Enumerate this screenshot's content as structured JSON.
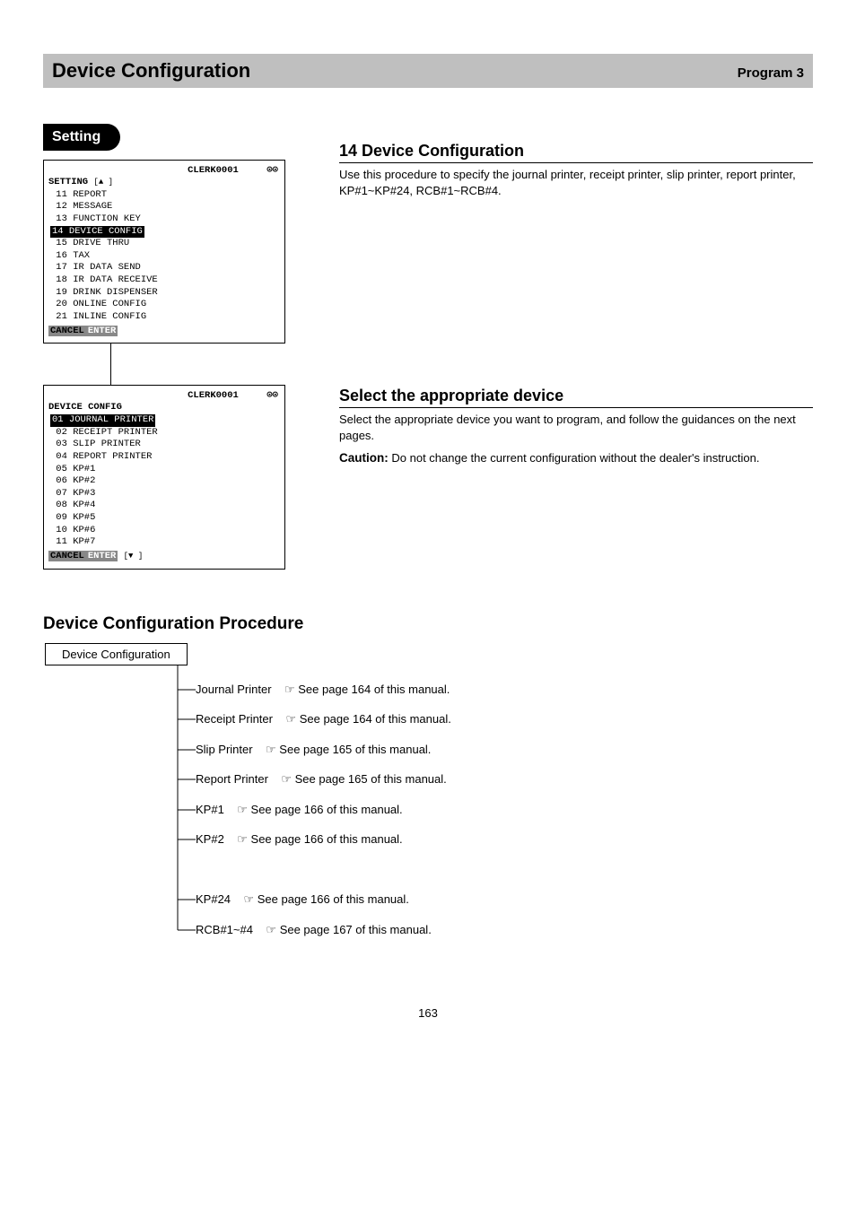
{
  "header": {
    "title": "Device Configuration",
    "sub": "Program 3"
  },
  "tab": "Setting",
  "screen1": {
    "user": "CLERK0001",
    "indicator": "⊙⊙",
    "menu_title": "SETTING",
    "up_marker": "[▲ ]",
    "items": [
      "11 REPORT",
      "12 MESSAGE",
      "13 FUNCTION KEY",
      "14 DEVICE CONFIG",
      "15 DRIVE THRU",
      "16 TAX",
      "17 IR DATA SEND",
      "18 IR DATA RECEIVE",
      "19 DRINK DISPENSER",
      "20 ONLINE CONFIG",
      "21 INLINE CONFIG"
    ],
    "selected_index": 3,
    "cancel": "CANCEL",
    "enter": "ENTER"
  },
  "right1": {
    "heading": "14 Device Configuration",
    "text": "Use this procedure to specify the journal printer, receipt printer, slip printer, report printer, KP#1~KP#24, RCB#1~RCB#4."
  },
  "screen2": {
    "user": "CLERK0001",
    "indicator": "⊙⊙",
    "menu_title": "DEVICE CONFIG",
    "items": [
      "01 JOURNAL PRINTER",
      "02 RECEIPT PRINTER",
      "03 SLIP PRINTER",
      "04 REPORT PRINTER",
      "05 KP#1",
      "06 KP#2",
      "07 KP#3",
      "08 KP#4",
      "09 KP#5",
      "10 KP#6",
      "11 KP#7"
    ],
    "selected_index": 0,
    "down_marker": "[▼ ]",
    "cancel": "CANCEL",
    "enter": "ENTER"
  },
  "right2": {
    "heading": "Select the appropriate device",
    "text": "Select the appropriate device you want to program, and follow the guidances on the next pages.",
    "caution_label": "Caution:",
    "caution_text": "Do not change the current configuration without the dealer's instruction."
  },
  "proc_title": "Device Configuration Procedure",
  "flow": {
    "root": "Device Configuration",
    "items": [
      {
        "label": "Journal Printer",
        "ref": "☞ See page 164 of this manual."
      },
      {
        "label": "Receipt Printer",
        "ref": "☞ See page 164 of this manual."
      },
      {
        "label": "Slip Printer",
        "ref": "☞ See page 165 of this manual."
      },
      {
        "label": "Report Printer",
        "ref": "☞ See page 165 of this manual."
      },
      {
        "label": "KP#1",
        "ref": "☞ See page 166 of this manual."
      },
      {
        "label": "KP#2",
        "ref": "☞ See page 166 of this manual."
      },
      {
        "label": "",
        "ref": ""
      },
      {
        "label": "KP#24",
        "ref": "☞ See page 166 of this manual."
      },
      {
        "label": "RCB#1~#4",
        "ref": "☞ See page 167 of this manual."
      }
    ]
  },
  "page_number": "163"
}
